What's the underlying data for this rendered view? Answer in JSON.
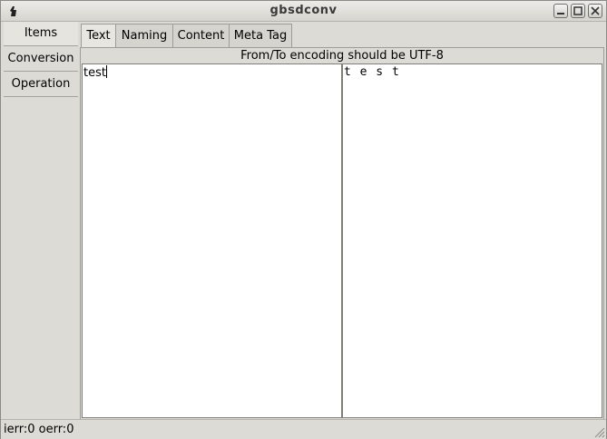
{
  "window": {
    "title": "gbsdconv",
    "controls": [
      "minimize-icon",
      "maximize-icon",
      "close-icon"
    ]
  },
  "sidebar": {
    "items": [
      {
        "label": "Items"
      },
      {
        "label": "Conversion"
      },
      {
        "label": "Operation"
      }
    ]
  },
  "tabs": [
    {
      "label": "Text",
      "active": true
    },
    {
      "label": "Naming"
    },
    {
      "label": "Content"
    },
    {
      "label": "Meta Tag"
    }
  ],
  "text_tab": {
    "hint": "From/To encoding should be UTF-8",
    "input_value": "test",
    "output_value": "t e s t"
  },
  "status": {
    "text": "ierr:0 oerr:0"
  }
}
